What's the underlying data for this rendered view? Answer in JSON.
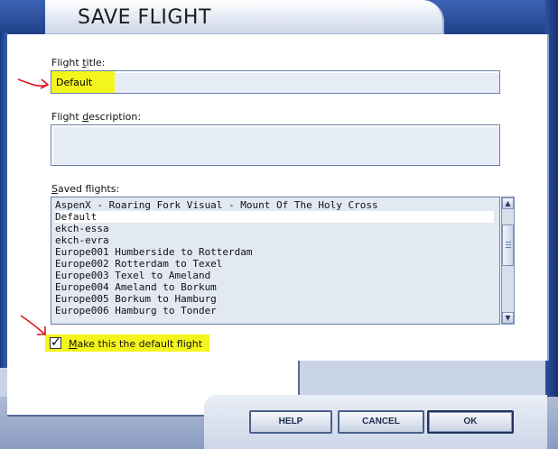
{
  "window": {
    "title": "SAVE FLIGHT"
  },
  "form": {
    "flight_title": {
      "label_prefix": "Flight ",
      "label_underlined": "t",
      "label_suffix": "itle:",
      "value": "Default"
    },
    "flight_description": {
      "label_prefix": "Flight ",
      "label_underlined": "d",
      "label_suffix": "escription:",
      "value": ""
    },
    "saved_flights": {
      "label_prefix": "",
      "label_underlined": "S",
      "label_suffix": "aved flights:",
      "items": [
        "AspenX - Roaring Fork Visual - Mount Of The Holy Cross",
        "Default",
        "ekch-essa",
        "ekch-evra",
        "Europe001 Humberside to Rotterdam",
        "Europe002 Rotterdam to Texel",
        "Europe003 Texel to Ameland",
        "Europe004 Ameland to Borkum",
        "Europe005 Borkum to Hamburg",
        "Europe006 Hamburg to Tonder"
      ],
      "selected": "Default"
    },
    "default_checkbox": {
      "label_underlined": "M",
      "label_suffix": "ake this the default flight",
      "checked": true
    }
  },
  "buttons": {
    "help": "HELP",
    "cancel": "CANCEL",
    "ok": "OK"
  },
  "colors": {
    "frame_blue": "#2b4c98",
    "highlight_yellow": "#f5f51e",
    "annotation_red": "#e0141e",
    "field_bg": "#e6ecf5"
  }
}
